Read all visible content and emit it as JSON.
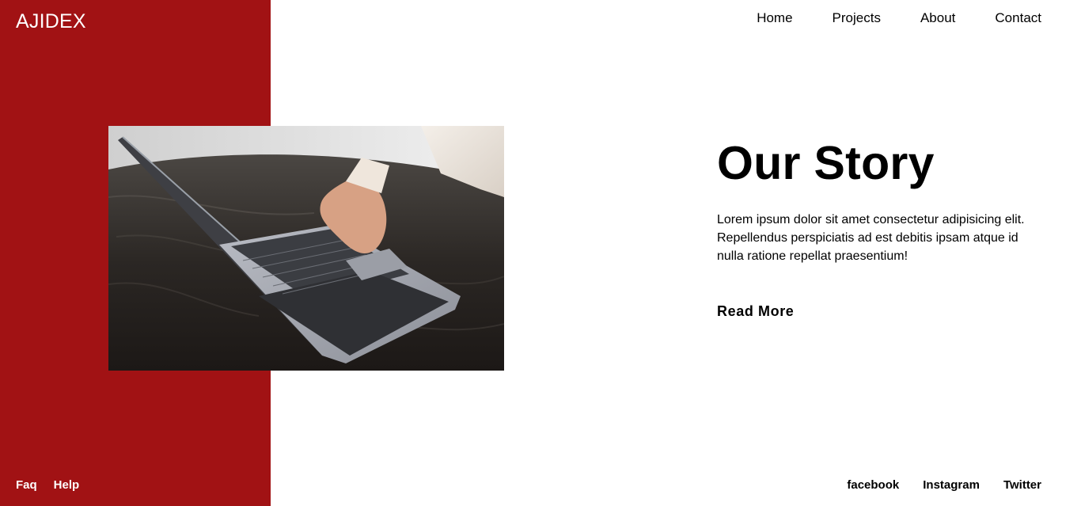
{
  "brand": {
    "name": "AJIDEX",
    "color": "#a11214"
  },
  "nav": {
    "items": [
      "Home",
      "Projects",
      "About",
      "Contact"
    ]
  },
  "hero": {
    "title": "Our Story",
    "body": "Lorem ipsum dolor sit amet consectetur adipisicing elit. Repellendus perspiciatis ad est debitis ipsam atque id nulla ratione repellat praesentium!",
    "cta": "Read More",
    "image_subject": "laptop-on-desk-photo"
  },
  "footer": {
    "left_links": [
      "Faq",
      "Help"
    ],
    "social_links": [
      "facebook",
      "Instagram",
      "Twitter"
    ]
  }
}
